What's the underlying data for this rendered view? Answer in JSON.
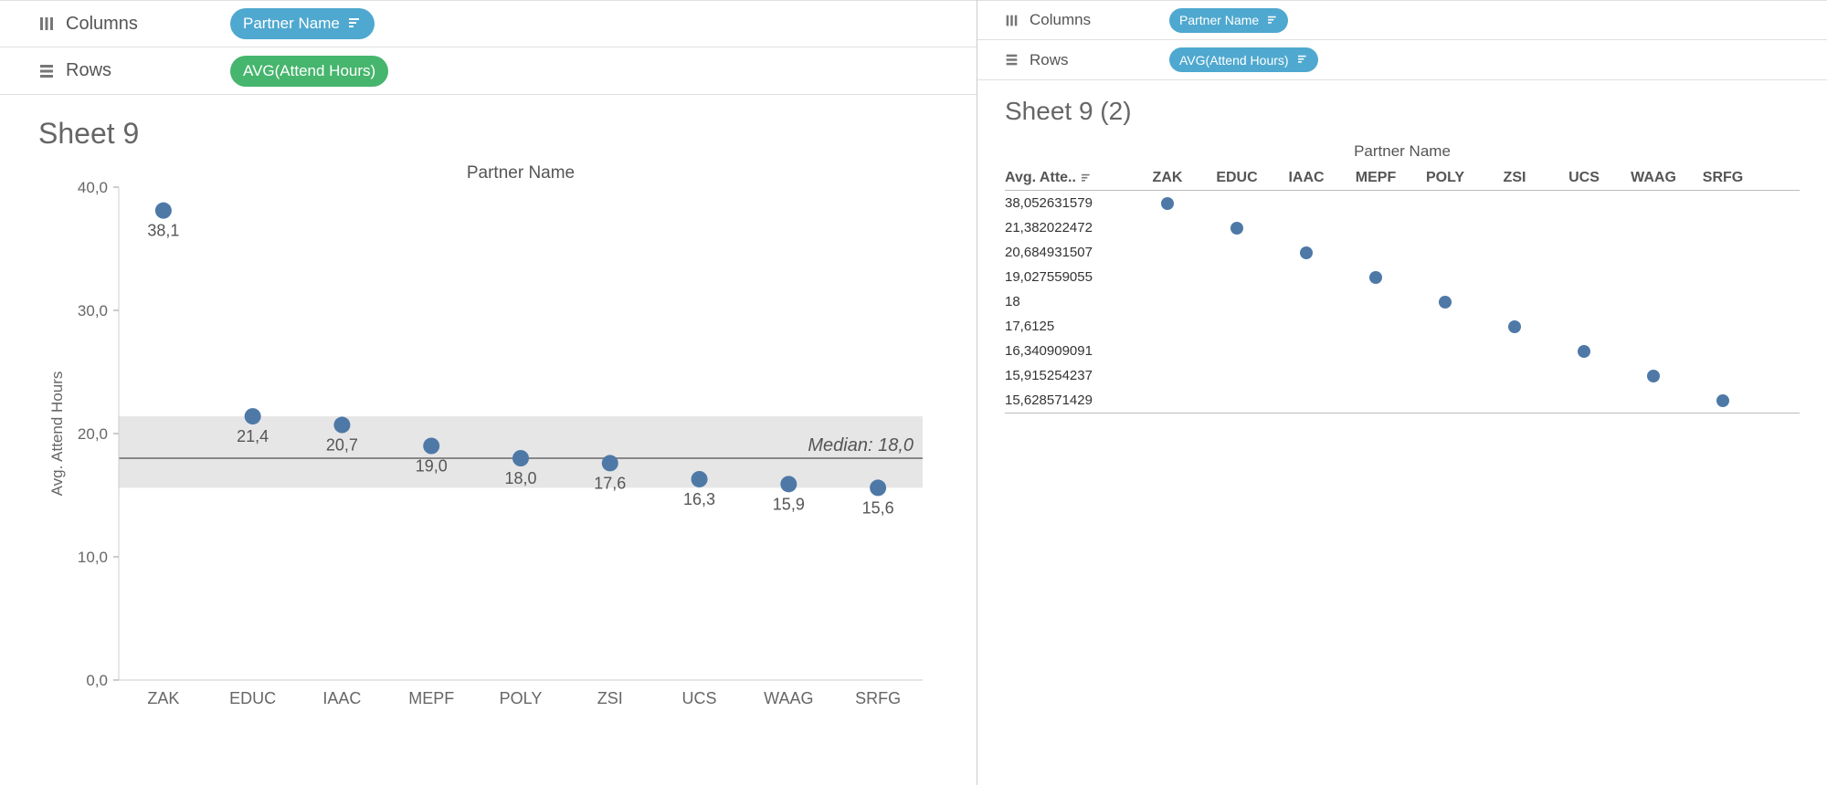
{
  "left": {
    "shelves": {
      "columns_label": "Columns",
      "rows_label": "Rows",
      "columns_pill": "Partner Name",
      "rows_pill": "AVG(Attend Hours)"
    },
    "sheet_title": "Sheet 9",
    "chart": {
      "x_title": "Partner Name",
      "y_title": "Avg. Attend Hours",
      "median_label": "Median: 18,0",
      "y_ticks": [
        "0,0",
        "10,0",
        "20,0",
        "30,0",
        "40,0"
      ]
    }
  },
  "right": {
    "shelves": {
      "columns_label": "Columns",
      "rows_label": "Rows",
      "columns_pill": "Partner Name",
      "rows_pill": "AVG(Attend Hours)"
    },
    "sheet_title": "Sheet 9 (2)",
    "xtab_title": "Partner Name",
    "rowhead_label": "Avg. Atte.."
  },
  "chart_data": [
    {
      "type": "scatter",
      "title": "Sheet 9",
      "xlabel": "Partner Name",
      "ylabel": "Avg. Attend Hours",
      "ylim": [
        0,
        40
      ],
      "median": 18.0,
      "median_band": [
        15.6,
        21.4
      ],
      "categories": [
        "ZAK",
        "EDUC",
        "IAAC",
        "MEPF",
        "POLY",
        "ZSI",
        "UCS",
        "WAAG",
        "SRFG"
      ],
      "values": [
        38.1,
        21.4,
        20.7,
        19.0,
        18.0,
        17.6,
        16.3,
        15.9,
        15.6
      ],
      "value_labels": [
        "38,1",
        "21,4",
        "20,7",
        "19,0",
        "18,0",
        "17,6",
        "16,3",
        "15,9",
        "15,6"
      ]
    },
    {
      "type": "table",
      "title": "Sheet 9 (2)",
      "xlabel": "Partner Name",
      "ylabel": "Avg. Attend Hours",
      "categories": [
        "ZAK",
        "EDUC",
        "IAAC",
        "MEPF",
        "POLY",
        "ZSI",
        "UCS",
        "WAAG",
        "SRFG"
      ],
      "row_values": [
        "38,052631579",
        "21,382022472",
        "20,684931507",
        "19,027559055",
        "18",
        "17,6125",
        "16,340909091",
        "15,915254237",
        "15,628571429"
      ]
    }
  ]
}
